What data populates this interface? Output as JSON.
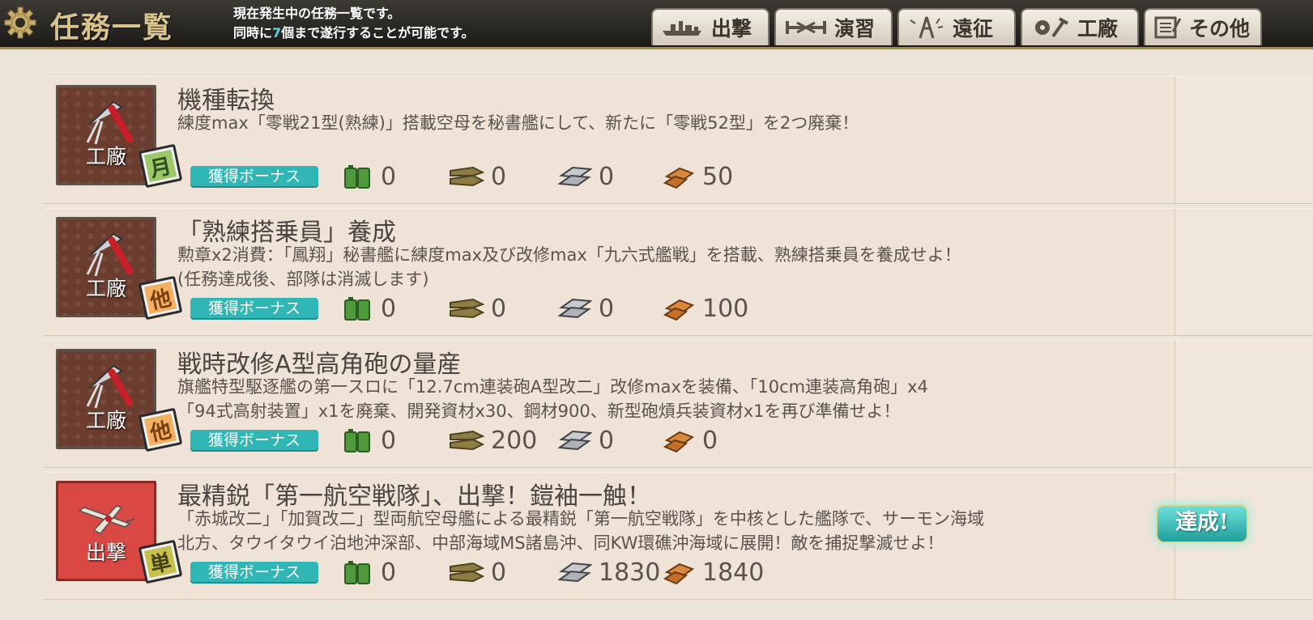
{
  "header": {
    "title": "任務一覧",
    "desc_line1": "現在発生中の任務一覧です。",
    "desc_line2_pre": "同時に",
    "desc_line2_num": "7",
    "desc_line2_post": "個まで遂行することが可能です。",
    "icon": "gear-icon"
  },
  "tabs": [
    {
      "label": "出撃",
      "icon": "fleet-icon"
    },
    {
      "label": "演習",
      "icon": "practice-icon"
    },
    {
      "label": "遠征",
      "icon": "expedition-icon"
    },
    {
      "label": "工廠",
      "icon": "arsenal-icon"
    },
    {
      "label": "その他",
      "icon": "notebook-icon"
    }
  ],
  "bonus_label": "獲得ボーナス",
  "quests": [
    {
      "category": "工廠",
      "frequency": "月",
      "title": "機種転換",
      "desc1": "練度max「零戦21型(熟練)」搭載空母を秘書艦にして、新たに「零戦52型」を2つ廃棄！",
      "desc2": "",
      "fuel": "0",
      "ammo": "0",
      "steel": "0",
      "bauxite": "50"
    },
    {
      "category": "工廠",
      "frequency": "他",
      "title": "「熟練搭乗員」養成",
      "desc1": "勲章x2消費：「鳳翔」秘書艦に練度max及び改修max「九六式艦戦」を搭載、熟練搭乗員を養成せよ！",
      "desc2": "(任務達成後、部隊は消滅します)",
      "fuel": "0",
      "ammo": "0",
      "steel": "0",
      "bauxite": "100"
    },
    {
      "category": "工廠",
      "frequency": "他",
      "title": "戦時改修A型高角砲の量産",
      "desc1": "旗艦特型駆逐艦の第一スロに「12.7cm連装砲A型改二」改修maxを装備、「10cm連装高角砲」x4",
      "desc2": "「94式高射装置」x1を廃棄、開発資材x30、鋼材900、新型砲熕兵装資材x1を再び準備せよ！",
      "fuel": "0",
      "ammo": "200",
      "steel": "0",
      "bauxite": "0"
    },
    {
      "category": "出撃",
      "frequency": "単",
      "title": "最精鋭「第一航空戦隊」、出撃！鎧袖一触！",
      "desc1": "「赤城改二」「加賀改二」型両航空母艦による最精鋭「第一航空戦隊」を中核とした艦隊で、サーモン海域",
      "desc2": "北方、タウイタウイ泊地沖深部、中部海域MS諸島沖、同KW環礁沖海域に展開！敵を捕捉撃滅せよ！",
      "fuel": "0",
      "ammo": "0",
      "steel": "1830",
      "bauxite": "1840",
      "status": "達成!"
    }
  ]
}
